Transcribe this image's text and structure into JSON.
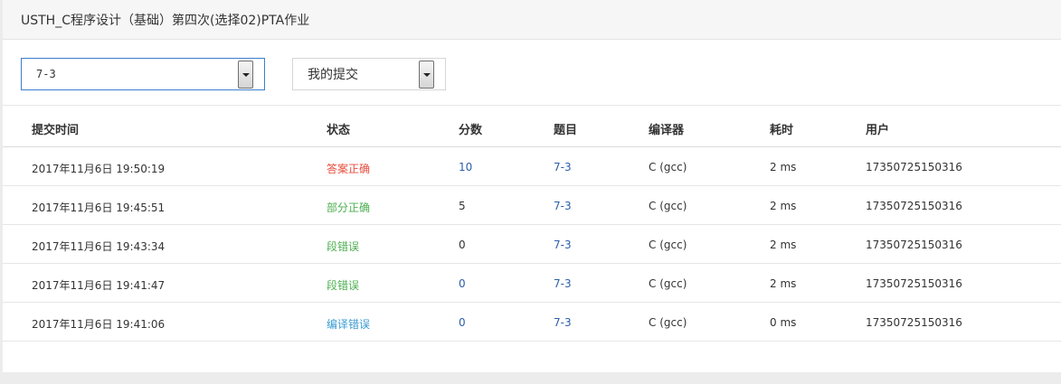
{
  "header": {
    "title": "USTH_C程序设计（基础）第四次(选择02)PTA作业"
  },
  "filters": {
    "problem": {
      "value": "7-3"
    },
    "scope": {
      "value": "我的提交"
    }
  },
  "table": {
    "columns": [
      "提交时间",
      "状态",
      "分数",
      "题目",
      "编译器",
      "耗时",
      "用户"
    ],
    "rows": [
      {
        "time": "2017年11月6日 19:50:19",
        "status": "答案正确",
        "status_color": "#e74c3c",
        "score": "10",
        "score_link": true,
        "problem": "7-3",
        "compiler": "C (gcc)",
        "cost": "2 ms",
        "user": "17350725150316"
      },
      {
        "time": "2017年11月6日 19:45:51",
        "status": "部分正确",
        "status_color": "#4caf50",
        "score": "5",
        "score_link": false,
        "problem": "7-3",
        "compiler": "C (gcc)",
        "cost": "2 ms",
        "user": "17350725150316"
      },
      {
        "time": "2017年11月6日 19:43:34",
        "status": "段错误",
        "status_color": "#4caf50",
        "score": "0",
        "score_link": false,
        "problem": "7-3",
        "compiler": "C (gcc)",
        "cost": "2 ms",
        "user": "17350725150316"
      },
      {
        "time": "2017年11月6日 19:41:47",
        "status": "段错误",
        "status_color": "#4caf50",
        "score": "0",
        "score_link": true,
        "problem": "7-3",
        "compiler": "C (gcc)",
        "cost": "2 ms",
        "user": "17350725150316"
      },
      {
        "time": "2017年11月6日 19:41:06",
        "status": "编译错误",
        "status_color": "#3a9bd1",
        "score": "0",
        "score_link": true,
        "problem": "7-3",
        "compiler": "C (gcc)",
        "cost": "0 ms",
        "user": "17350725150316"
      }
    ]
  },
  "colors": {
    "link": "#2b5ea9",
    "select_focus_border": "#3b7ed0"
  }
}
